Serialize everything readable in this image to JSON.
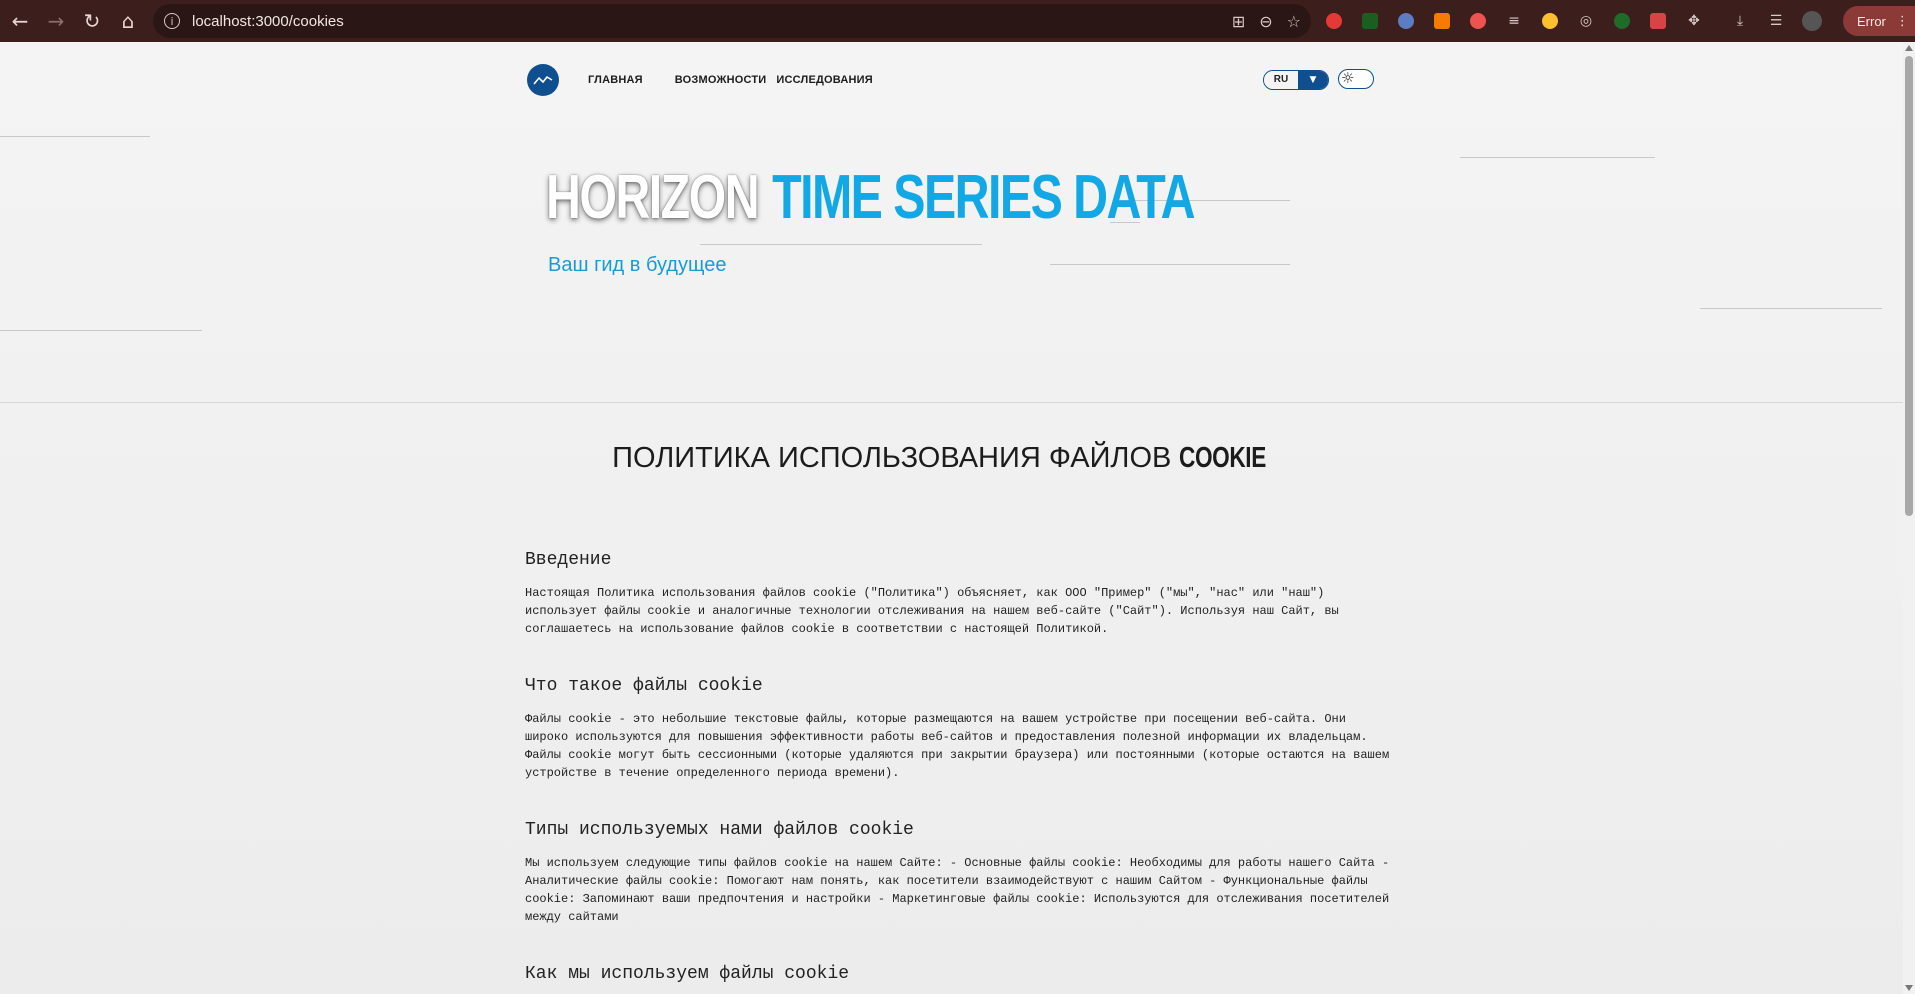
{
  "browser": {
    "url": "localhost:3000/cookies",
    "profile_status": "Error",
    "nav_icons": [
      "back-icon",
      "forward-icon",
      "reload-icon",
      "home-icon"
    ],
    "omnibox_icons": [
      "translate-icon",
      "zoom-icon",
      "bookmark-star-icon"
    ]
  },
  "site": {
    "nav": {
      "home": "ГЛАВНАЯ",
      "features": "ВОЗМОЖНОСТИ",
      "research": "ИССЛЕДОВАНИЯ"
    },
    "language": "RU",
    "hero": {
      "title_white": "HORIZON",
      "title_blue": "TIME SERIES DATA",
      "subtitle": "Ваш гид в будущее"
    },
    "policy": {
      "title_main": "ПОЛИТИКА ИСПОЛЬЗОВАНИЯ ФАЙЛОВ",
      "title_bold": "COOKIE",
      "sections": [
        {
          "heading": "Введение",
          "body": "Настоящая Политика использования файлов cookie (\"Политика\") объясняет, как ООО \"Пример\" (\"мы\", \"нас\" или \"наш\") использует файлы cookie и аналогичные технологии отслеживания на нашем веб-сайте (\"Сайт\"). Используя наш Сайт, вы соглашаетесь на использование файлов cookie в соответствии с настоящей Политикой."
        },
        {
          "heading": "Что такое файлы cookie",
          "body": "Файлы cookie - это небольшие текстовые файлы, которые размещаются на вашем устройстве при посещении веб-сайта. Они широко используются для повышения эффективности работы веб-сайтов и предоставления полезной информации их владельцам. Файлы cookie могут быть сессионными (которые удаляются при закрытии браузера) или постоянными (которые остаются на вашем устройстве в течение определенного периода времени)."
        },
        {
          "heading": "Типы используемых нами файлов cookie",
          "body": "Мы используем следующие типы файлов cookie на нашем Сайте: - Основные файлы cookie: Необходимы для работы нашего Сайта - Аналитические файлы cookie: Помогают нам понять, как посетители взаимодействуют с нашим Сайтом - Функциональные файлы cookie: Запоминают ваши предпочтения и настройки - Маркетинговые файлы cookie: Используются для отслеживания посетителей между сайтами"
        },
        {
          "heading": "Как мы используем файлы cookie",
          "body": ""
        }
      ]
    },
    "dev_badge": "N"
  },
  "colors": {
    "chrome_bg": "#3c1f1d",
    "brand_blue": "#0f4f8f",
    "accent_cyan": "#12a8e6"
  }
}
